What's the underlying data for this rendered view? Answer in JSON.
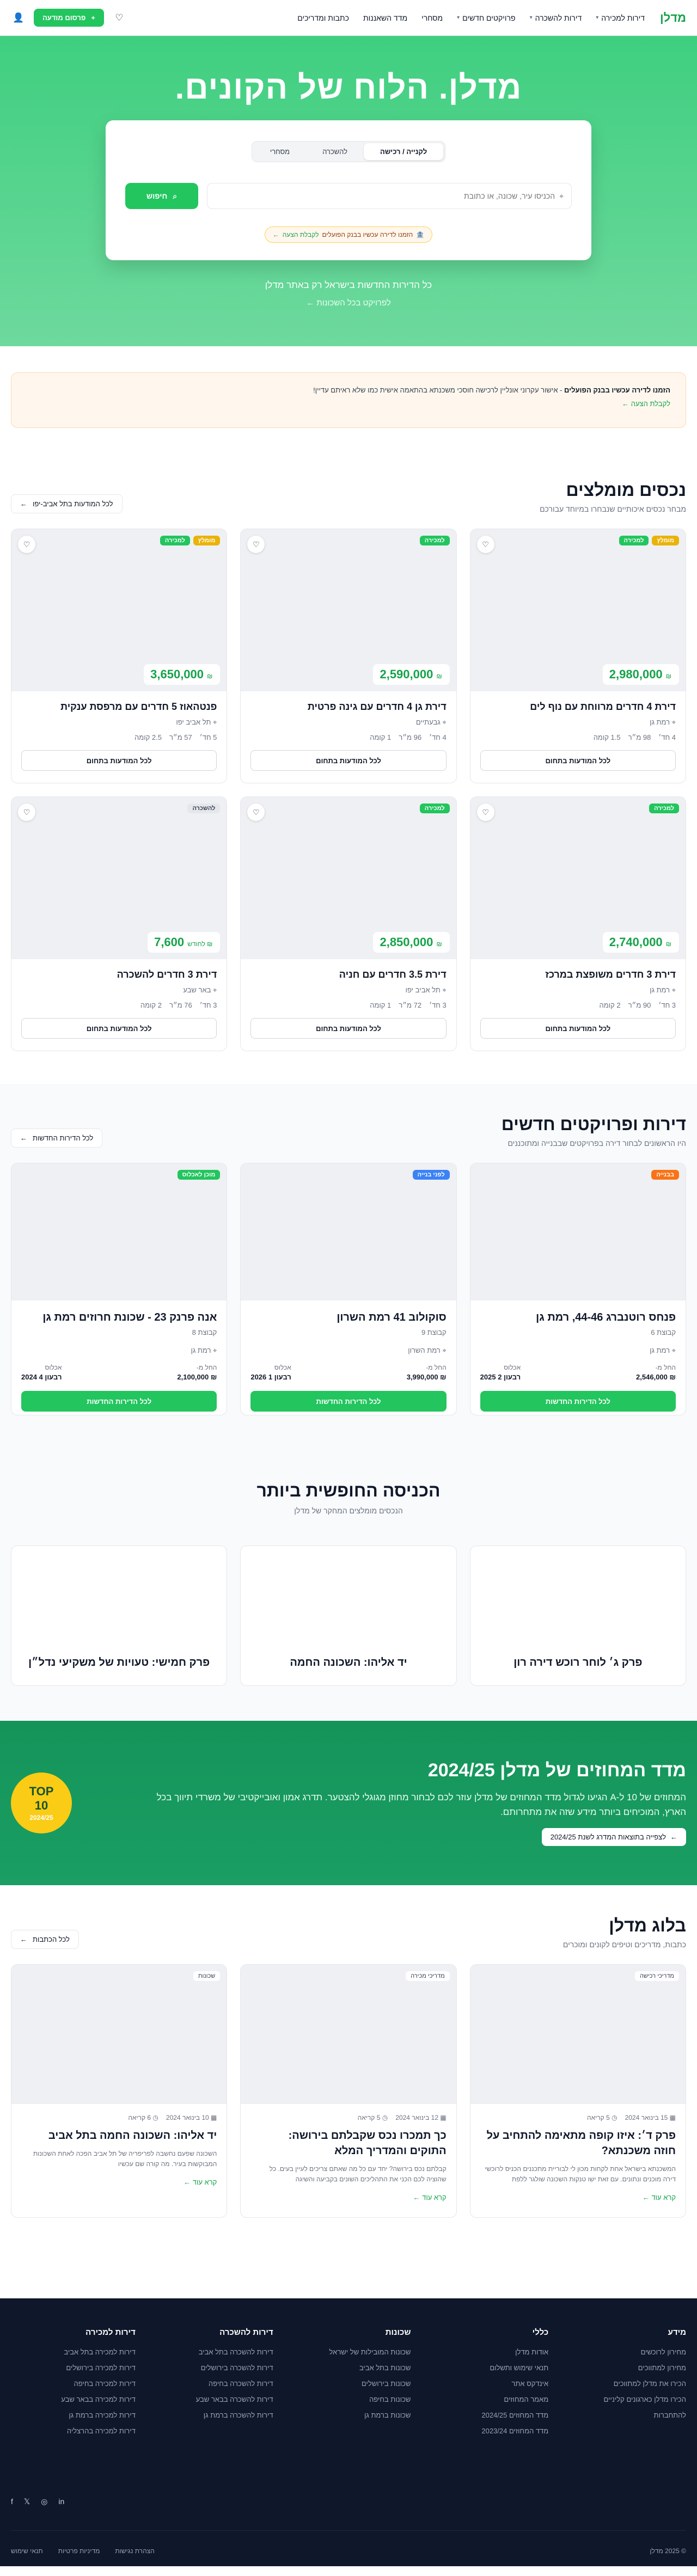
{
  "header": {
    "logo": "מדלן",
    "nav": [
      "דירות למכירה",
      "דירות להשכרה",
      "פרויקטים חדשים",
      "מסחרי",
      "מדד השאננות",
      "כתבות ומדריכים"
    ],
    "post_button": "פרסום מודעה"
  },
  "hero": {
    "title": "מדלן. הלוח של הקונים.",
    "tabs": [
      "לקנייה / רכישה",
      "להשכרה",
      "מסחרי"
    ],
    "search_placeholder": "הכניסו עיר, שכונה, או כתובת",
    "search_button": "חיפוש",
    "promo_text": "הזמנו לדירה עכשיו בבנק הפועלים",
    "promo_link": "לקבלת הצעה",
    "sub": "כל הדירות החדשות בישראל רק באתר מדלן",
    "link": "לפרויקט בכל השכונות"
  },
  "notice": {
    "bold": "הזמנו לדירה עכשיו בבנק הפועלים",
    "text": " - אישור עקרוני אונליין לרכישה חוסכי משכנתא בהתאמה אישית כמו שלא ראיתם עדיין!",
    "link": "לקבלת הצעה"
  },
  "featured": {
    "title": "נכסים מומלצים",
    "sub": "מבחר נכסים איכותיים שנבחרו במיוחד עבורכם",
    "link": "לכל המודעות בתל אביב-יפו",
    "cards": [
      {
        "badges": [
          "מומלץ",
          "למכירה"
        ],
        "price": "2,980,000",
        "unit": "₪",
        "title": "דירת 4 חדרים מרווחת עם נוף לים",
        "loc": "רמת גן",
        "rooms": "4 חד׳",
        "area": "98 מ״ר",
        "floor": "1.5 קומה",
        "btn": "לכל המודעות בתחום"
      },
      {
        "badges": [
          "למכירה"
        ],
        "price": "2,590,000",
        "unit": "₪",
        "title": "דירת גן 4 חדרים עם גינה פרטית",
        "loc": "גבעתיים",
        "rooms": "4 חד׳",
        "area": "96 מ״ר",
        "floor": "1 קומה",
        "btn": "לכל המודעות בתחום"
      },
      {
        "badges": [
          "מומלץ",
          "למכירה"
        ],
        "price": "3,650,000",
        "unit": "₪",
        "title": "פנטהאוז 5 חדרים עם מרפסת ענקית",
        "loc": "תל אביב יפו",
        "rooms": "5 חד׳",
        "area": "57 מ״ר",
        "floor": "2.5 קומה",
        "btn": "לכל המודעות בתחום"
      },
      {
        "badges": [
          "למכירה"
        ],
        "price": "2,740,000",
        "unit": "₪",
        "title": "דירת 3 חדרים משופצת במרכז",
        "loc": "רמת גן",
        "rooms": "3 חד׳",
        "area": "90 מ״ר",
        "floor": "2 קומה",
        "btn": "לכל המודעות בתחום"
      },
      {
        "badges": [
          "למכירה"
        ],
        "price": "2,850,000",
        "unit": "₪",
        "title": "דירת 3.5 חדרים עם חניה",
        "loc": "תל אביב יפו",
        "rooms": "3 חד׳",
        "area": "72 מ״ר",
        "floor": "1 קומה",
        "btn": "לכל המודעות בתחום"
      },
      {
        "badges": [
          "להשכרה"
        ],
        "price": "7,600",
        "unit": "₪ לחודש",
        "title": "דירת 3 חדרים להשכרה",
        "loc": "באר שבע",
        "rooms": "3 חד׳",
        "area": "76 מ״ר",
        "floor": "2 קומה",
        "btn": "לכל המודעות בתחום"
      }
    ]
  },
  "projects": {
    "title": "דירות ופרויקטים חדשים",
    "sub": "היו הראשונים לבחור דירה בפרויקטים שבבנייה ומתוכננים",
    "link": "לכל הדירות החדשות",
    "cards": [
      {
        "badge": "בבנייה",
        "title": "פנחס רוטנברג 44-46, רמת גן",
        "dev": "קבוצת 6",
        "loc": "רמת גן",
        "price_label": "החל מ-",
        "price": "₪ 2,546,000",
        "deliv_label": "אכלוס",
        "deliv": "רבעון 2 2025",
        "btn": "לכל הדירות החדשות"
      },
      {
        "badge": "לפני בנייה",
        "title": "סוקולוב 41 רמת השרון",
        "dev": "קבוצת 9",
        "loc": "רמת השרון",
        "price_label": "החל מ-",
        "price": "₪ 3,990,000",
        "deliv_label": "אכלוס",
        "deliv": "רבעון 1 2026",
        "btn": "לכל הדירות החדשות"
      },
      {
        "badge": "מוכן לאכלוס",
        "title": "אנה פרנק 23 - שכונת חרוזים רמת גן",
        "dev": "קבוצת 8",
        "loc": "רמת גן",
        "price_label": "החל מ-",
        "price": "₪ 2,100,000",
        "deliv_label": "אכלוס",
        "deliv": "רבעון 4 2024",
        "btn": "לכל הדירות החדשות"
      }
    ]
  },
  "hoods": {
    "title": "הכניסה החופשית ביותר",
    "sub": "הנכסים מומלצים המחקר של מדלן",
    "cards": [
      "פרק ג׳ לוחר רוכש דירה רון",
      "יד אליהו: השכונה החמה",
      "פרק חמישי: טעויות של משקיעי נדל״ן"
    ]
  },
  "index": {
    "title": "מדד המחוזים של מדלן 2024/25",
    "text": "המחוזים של 10 ל-A הגיעו לגדול מדד המחוזים של מדלן עוזר לכם לבחור מחוזן מגוגלי להצטער. תדרג אמון ואובייקטיבי של משרדי תיווך בכל הארץ, המוכיחים ביותר מידע שזה את מתחרותם.",
    "btn": "לצפייה בתוצאות המדרג לשנת 2024/25",
    "badge_top": "TOP",
    "badge_num": "10",
    "badge_year": "2024/25"
  },
  "blog": {
    "title": "בלוג מדלן",
    "sub": "כתבות, מדריכים וטיפים לקונים ומוכרים",
    "link": "לכל הכתבות",
    "read": "קרא עוד",
    "cards": [
      {
        "tag": "מדריכי רכישה",
        "date": "15 בינואר 2024",
        "time": "5 קריאה",
        "title": "פרק ד׳: איזו קופה מתאימה להתחיב על חוזה משכנתא?",
        "excerpt": "המשכנתא בישראל אחת לקחות מכון לי לבוריית מתכננים הכניס לרוכשי דירה מוכנים ונתונים. עם זאת ישו טנקות השכונה שולגר ללפת"
      },
      {
        "tag": "מדריכי מכירה",
        "date": "12 בינואר 2024",
        "time": "5 קריאה",
        "title": "כך תמכרו נכס שקבלתם בירושה: התוקים והמדריך המלא",
        "excerpt": "קבלתם נכס בירושה? יחד עם כל מה שאתם צריכים לעיין בעים. כל שהוציה לכם הכני את התהליכים השונים בקביעה והשיגה"
      },
      {
        "tag": "שכונות",
        "date": "10 בינואר 2024",
        "time": "6 קריאה",
        "title": "יד אליהו: השכונה החמה בתל אביב",
        "excerpt": "השכונה שפעם נחשבה לפריפריה של תל אביב הפכה לאחת השכונות המבוקשות בעיר. מה קורה שם עכשיו"
      }
    ]
  },
  "footer": {
    "cols": [
      {
        "title": "מידע",
        "items": [
          "מחירון לרוכשים",
          "מחירון למתווכים",
          "הכירו את מדלן למתווכים",
          "הכירו מדלן כארגונים קליניים",
          "להתחברות"
        ]
      },
      {
        "title": "כללי",
        "items": [
          "אודות מדלן",
          "תנאי שימוש ותשלום",
          "אינדקס אתר",
          "מאמר המחוזים",
          "מדד המחוזים 2024/25",
          "מדד המחוזים 2023/24"
        ]
      },
      {
        "title": "שכונות",
        "items": [
          "שכונות המובילות של ישראל",
          "שכונות בתל אביב",
          "שכונות בירושלים",
          "שכונות בחיפה",
          "שכונות ברמת גן"
        ]
      },
      {
        "title": "דירות להשכרה",
        "items": [
          "דירות להשכרה בתל אביב",
          "דירות להשכרה בירושלים",
          "דירות להשכרה בחיפה",
          "דירות להשכרה בבאר שבע",
          "דירות להשכרה ברמת גן"
        ]
      },
      {
        "title": "דירות למכירה",
        "items": [
          "דירות למכירה בתל אביב",
          "דירות למכירה בירושלים",
          "דירות למכירה בחיפה",
          "דירות למכירה בבאר שבע",
          "דירות למכירה ברמת גן",
          "דירות למכירה בהרצליה"
        ]
      }
    ],
    "social": [
      "f",
      "𝕏",
      "◎",
      "in"
    ],
    "copyright": "© 2025 מדלן",
    "links": [
      "הצהרת נגישות",
      "מדיניות פרטיות",
      "תנאי שימוש"
    ]
  }
}
